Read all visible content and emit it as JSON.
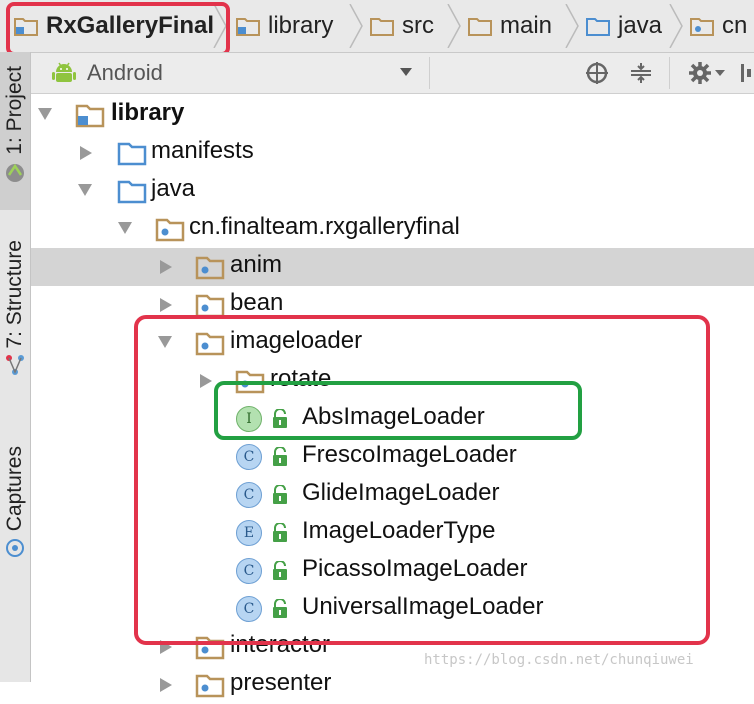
{
  "breadcrumb": {
    "items": [
      {
        "label": "RxGalleryFinal",
        "icon": "module-folder-icon"
      },
      {
        "label": "library",
        "icon": "module-folder-icon"
      },
      {
        "label": "src",
        "icon": "folder-icon"
      },
      {
        "label": "main",
        "icon": "folder-icon"
      },
      {
        "label": "java",
        "icon": "source-folder-icon"
      },
      {
        "label": "cn",
        "icon": "package-icon"
      }
    ]
  },
  "toolstrip": {
    "tabs": [
      {
        "label": "1: Project",
        "icon": "android-icon"
      },
      {
        "label": "7: Structure",
        "icon": "structure-icon"
      },
      {
        "label": "Captures",
        "icon": "captures-icon"
      }
    ]
  },
  "header": {
    "view_label": "Android",
    "actions": [
      "scroll-from-source-icon",
      "collapse-all-icon",
      "settings-icon",
      "hide-icon"
    ]
  },
  "tree": {
    "nodes": [
      {
        "label": "library",
        "kind": "module",
        "expanded": true
      },
      {
        "label": "manifests",
        "kind": "folder",
        "expanded": false
      },
      {
        "label": "java",
        "kind": "folder",
        "expanded": true
      },
      {
        "label": "cn.finalteam.rxgalleryfinal",
        "kind": "package",
        "expanded": true
      },
      {
        "label": "anim",
        "kind": "package",
        "expanded": false,
        "selected": true
      },
      {
        "label": "bean",
        "kind": "package",
        "expanded": false
      },
      {
        "label": "imageloader",
        "kind": "package",
        "expanded": true
      },
      {
        "label": "rotate",
        "kind": "package",
        "expanded": false
      },
      {
        "label": "AbsImageLoader",
        "kind": "interface",
        "badge": "I"
      },
      {
        "label": "FrescoImageLoader",
        "kind": "class",
        "badge": "C"
      },
      {
        "label": "GlideImageLoader",
        "kind": "class",
        "badge": "C"
      },
      {
        "label": "ImageLoaderType",
        "kind": "enum",
        "badge": "E"
      },
      {
        "label": "PicassoImageLoader",
        "kind": "class",
        "badge": "C"
      },
      {
        "label": "UniversalImageLoader",
        "kind": "class",
        "badge": "C"
      },
      {
        "label": "interactor",
        "kind": "package",
        "expanded": false
      },
      {
        "label": "presenter",
        "kind": "package",
        "expanded": false
      }
    ]
  },
  "watermark": "https://blog.csdn.net/chunqiuwei",
  "colors": {
    "annotation_red": "#e2334b",
    "annotation_green": "#22a042",
    "folder": "#c9a774",
    "source_folder": "#5b9bd5",
    "selection": "#d4d4d4"
  }
}
